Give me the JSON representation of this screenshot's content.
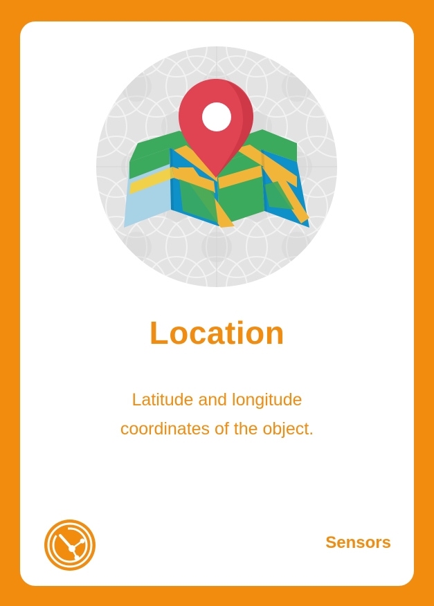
{
  "card": {
    "title": "Location",
    "description_line1": "Latitude and longitude",
    "description_line2": "coordinates of the object.",
    "category": "Sensors",
    "icon": "map-with-location-pin-icon",
    "category_icon": "sensor-gauge-icon"
  },
  "colors": {
    "frame": "#F28C0F",
    "card": "#FFFFFF",
    "text": "#F28C0F",
    "pin": "#E04452",
    "map_green": "#3BAA5C",
    "map_blue": "#0E90C8",
    "map_light_blue": "#A8D3E6",
    "map_road": "#F1B53A"
  }
}
